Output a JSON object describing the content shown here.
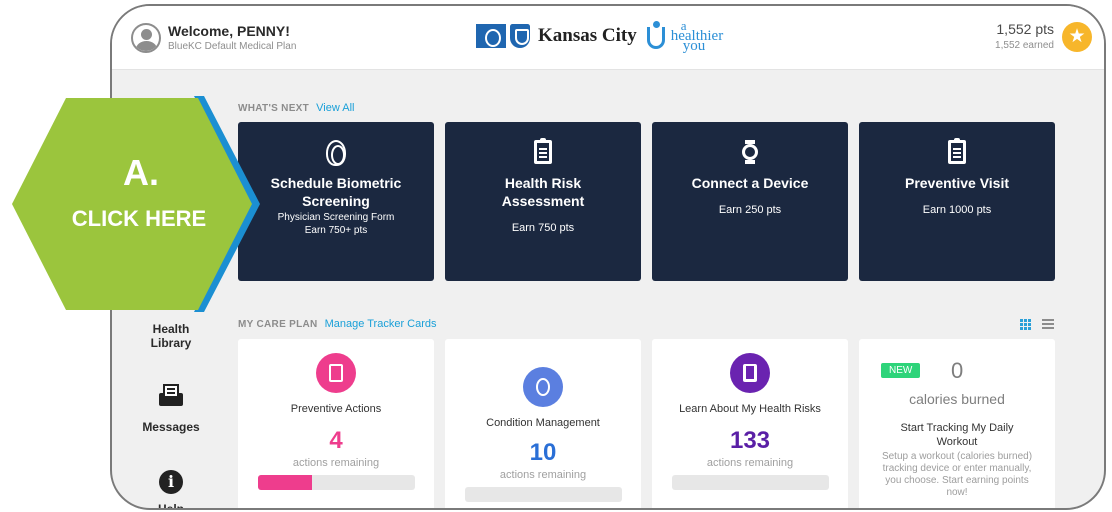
{
  "header": {
    "welcome": "Welcome, PENNY!",
    "plan": "BlueKC Default Medical Plan",
    "logo_city": "Kansas City",
    "logo_tagline_a": "a",
    "logo_tagline_healthier": "healthier",
    "logo_tagline_you": "you",
    "points": "1,552 pts",
    "earned": "1,552 earned",
    "star_icon": "star-icon"
  },
  "callout": {
    "letter": "A.",
    "text": "CLICK HERE",
    "fill_color": "#9bc53d",
    "edge_color": "#1b8fd2"
  },
  "whats_next": {
    "heading": "WHAT'S NEXT",
    "link": "View All",
    "cards": [
      {
        "icon": "fingerprint-icon",
        "title": "Schedule Biometric Screening",
        "line1": "Physician Screening Form",
        "line2": "Earn 750+ pts"
      },
      {
        "icon": "clipboard-icon",
        "title": "Health Risk Assessment",
        "line1": "Earn 750 pts"
      },
      {
        "icon": "watch-icon",
        "title": "Connect a Device",
        "line1": "Earn 250 pts"
      },
      {
        "icon": "clipboard-icon",
        "title": "Preventive Visit",
        "line1": "Earn 1000 pts"
      }
    ]
  },
  "sidebar": {
    "health_library": "Health\nLibrary",
    "messages": "Messages",
    "help": "Help"
  },
  "care_plan": {
    "heading": "MY CARE PLAN",
    "link": "Manage Tracker Cards",
    "cards": [
      {
        "icon": "clipboard-icon",
        "color": "#ee3d8d",
        "label": "Preventive Actions",
        "count": "4",
        "count_color": "#ee3d8d",
        "sub": "actions remaining",
        "progress": 0.35
      },
      {
        "icon": "handshake-heart-icon",
        "color": "#5b7fe0",
        "label": "Condition Management",
        "count": "10",
        "count_color": "#2a6fd6",
        "sub": "actions remaining",
        "progress": 0
      },
      {
        "icon": "book-icon",
        "color": "#6a23b0",
        "label": "Learn About My Health Risks",
        "count": "133",
        "count_color": "#5a1fa6",
        "sub": "actions remaining",
        "progress": 0
      }
    ],
    "tracker": {
      "badge": "NEW",
      "value": "0",
      "unit": "calories burned",
      "title": "Start Tracking My Daily Workout",
      "description": "Setup a workout (calories burned) tracking device or enter manually, you choose. Start earning points now!"
    }
  }
}
